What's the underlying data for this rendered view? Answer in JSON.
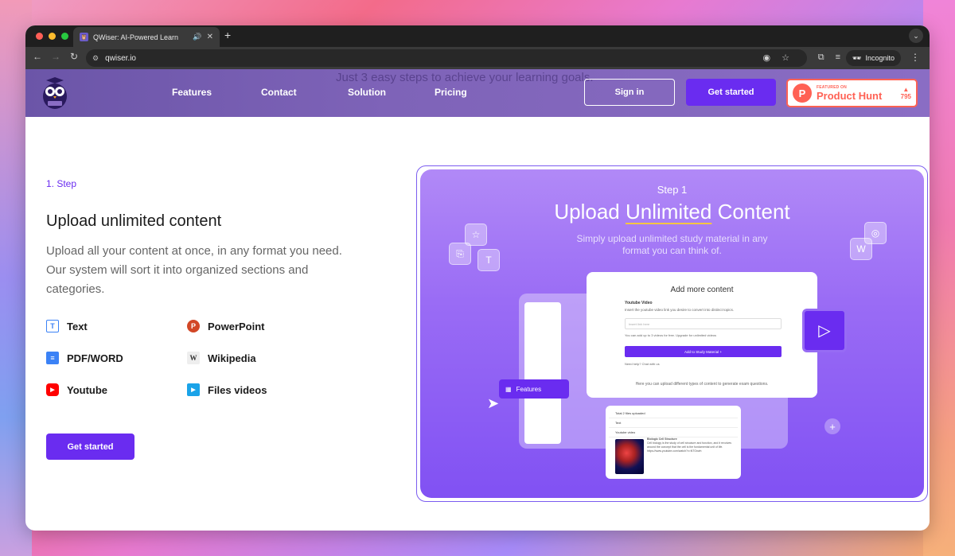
{
  "browser": {
    "tab_title": "QWiser: AI-Powered Learn",
    "url": "qwiser.io",
    "incognito_label": "Incognito"
  },
  "site": {
    "ghost_text": "Just 3 easy steps to achieve your learning goals.",
    "nav": [
      "Features",
      "Contact",
      "Solution",
      "Pricing"
    ],
    "signin_label": "Sign in",
    "get_started_label": "Get started",
    "product_hunt": {
      "small": "FEATURED ON",
      "big": "Product Hunt",
      "votes": "795"
    }
  },
  "step": {
    "label": "1. Step",
    "heading": "Upload unlimited content",
    "paragraph": "Upload all your content at once, in any format you need. Our system will sort it into organized sections and categories.",
    "formats": [
      {
        "label": "Text",
        "icon": "text-icon"
      },
      {
        "label": "PowerPoint",
        "icon": "powerpoint-icon"
      },
      {
        "label": "PDF/WORD",
        "icon": "document-icon"
      },
      {
        "label": "Wikipedia",
        "icon": "wikipedia-icon"
      },
      {
        "label": "Youtube",
        "icon": "youtube-icon"
      },
      {
        "label": "Files videos",
        "icon": "video-file-icon"
      }
    ],
    "cta_label": "Get started"
  },
  "illustration": {
    "step": "Step 1",
    "title_pre": "Upload ",
    "title_under": "Unlimited",
    "title_post": " Content",
    "subtitle": "Simply upload unlimited study material in any format you can think of.",
    "card_title": "Add more content",
    "yt_label": "Youtube Video",
    "yt_desc": "Insert the youtube video link you desire to convert into distinct topics.",
    "input_placeholder": "Insert link here",
    "limit_text": "You can add up to 3 videos for free. Upgrade for unlimited videos",
    "add_button": "Add to Study Material +",
    "help_text": "Need help? Chat with us",
    "footer_text": "Here you can upload different types of content to generate exam questions.",
    "features_pill": "Features",
    "bottom_rows": [
      "Total 2 files uploaded",
      "Text",
      "Youtube video"
    ],
    "bottom_title": "Biologic Cell Structure",
    "bottom_desc": "Cell biology is the study of cell structure and function, and it revolves around the concept that the cell is the fundamental unit of life.",
    "bottom_link": "https://www.youtube.com/watch?v=NTOnwh"
  },
  "colors": {
    "accent": "#6a2cf0",
    "nav_bg": "#7e63b8",
    "product_hunt": "#ff6154"
  }
}
